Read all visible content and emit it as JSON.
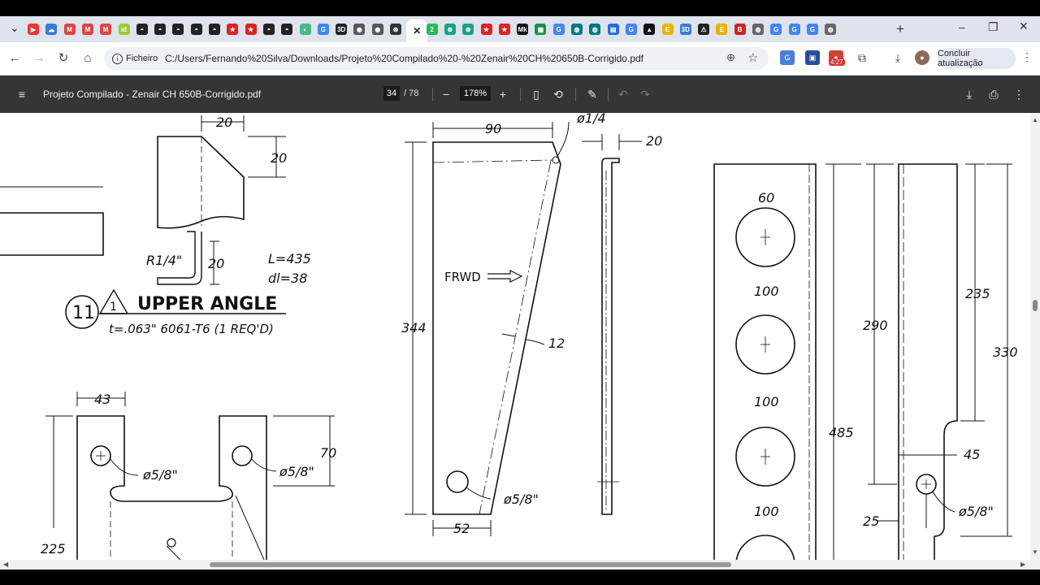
{
  "browser": {
    "tab_icons": [
      "youtube-icon",
      "cloud-icon",
      "gmail-icon",
      "gmail-icon",
      "gmail-icon",
      "id-icon",
      "avatar-icon",
      "avatar-icon",
      "avatar-icon",
      "avatar-icon",
      "avatar-icon",
      "record-icon",
      "record-icon",
      "avatar-icon",
      "avatar-icon",
      "chrome-icon",
      "google-icon",
      "3d-icon",
      "circle-icon",
      "circle-icon",
      "chatgpt-icon",
      "close-icon",
      "whatsapp-icon",
      "chatgpt-icon",
      "chatgpt-icon",
      "record-icon",
      "record-icon",
      "mk-icon",
      "sheets-icon",
      "google-icon",
      "nuvem-icon",
      "nuvem-icon",
      "forms-icon",
      "google-icon",
      "hat-icon",
      "notes-icon",
      "3d-icon",
      "alert-icon",
      "notes-icon",
      "b-icon",
      "globe-icon",
      "google-icon",
      "google-icon",
      "google-icon",
      "globe-icon"
    ],
    "new_tab": "+",
    "address_chip": "Ficheiro",
    "url": "C:/Users/Fernando%20Silva/Downloads/Projeto%20Compilado%20-%20Zenair%20CH%20650B-Corrigido.pdf",
    "badge_time": "4:27",
    "update_button": "Concluir atualização"
  },
  "pdf": {
    "title": "Projeto Compilado - Zenair CH 650B-Corrigido.pdf",
    "page_current": "34",
    "page_total": "/ 78",
    "zoom": "178%"
  },
  "drawing": {
    "dims": {
      "d20_top": "20",
      "d20_right": "20",
      "d20_angle": "20",
      "r14": "R1/4\"",
      "l435": "L=435",
      "dl38": "dl=38",
      "part_num": "11",
      "rev": "1",
      "part_name": "UPPER ANGLE",
      "material": "t=.063\" 6061-T6 (1 REQ'D)",
      "d43": "43",
      "hole58a": "ø5/8\"",
      "hole58b": "ø5/8\"",
      "d70": "70",
      "d225": "225",
      "d90": "90",
      "phi14": "ø1/4",
      "d20b": "20",
      "frwd": "FRWD",
      "d344": "344",
      "d12": "12",
      "hole58c": "ø5/8\"",
      "d52": "52",
      "d60": "60",
      "d100a": "100",
      "d100b": "100",
      "d100c": "100",
      "d290": "290",
      "d485": "485",
      "d235": "235",
      "d330": "330",
      "d45": "45",
      "d25": "25",
      "hole58d": "ø5/8\""
    }
  }
}
